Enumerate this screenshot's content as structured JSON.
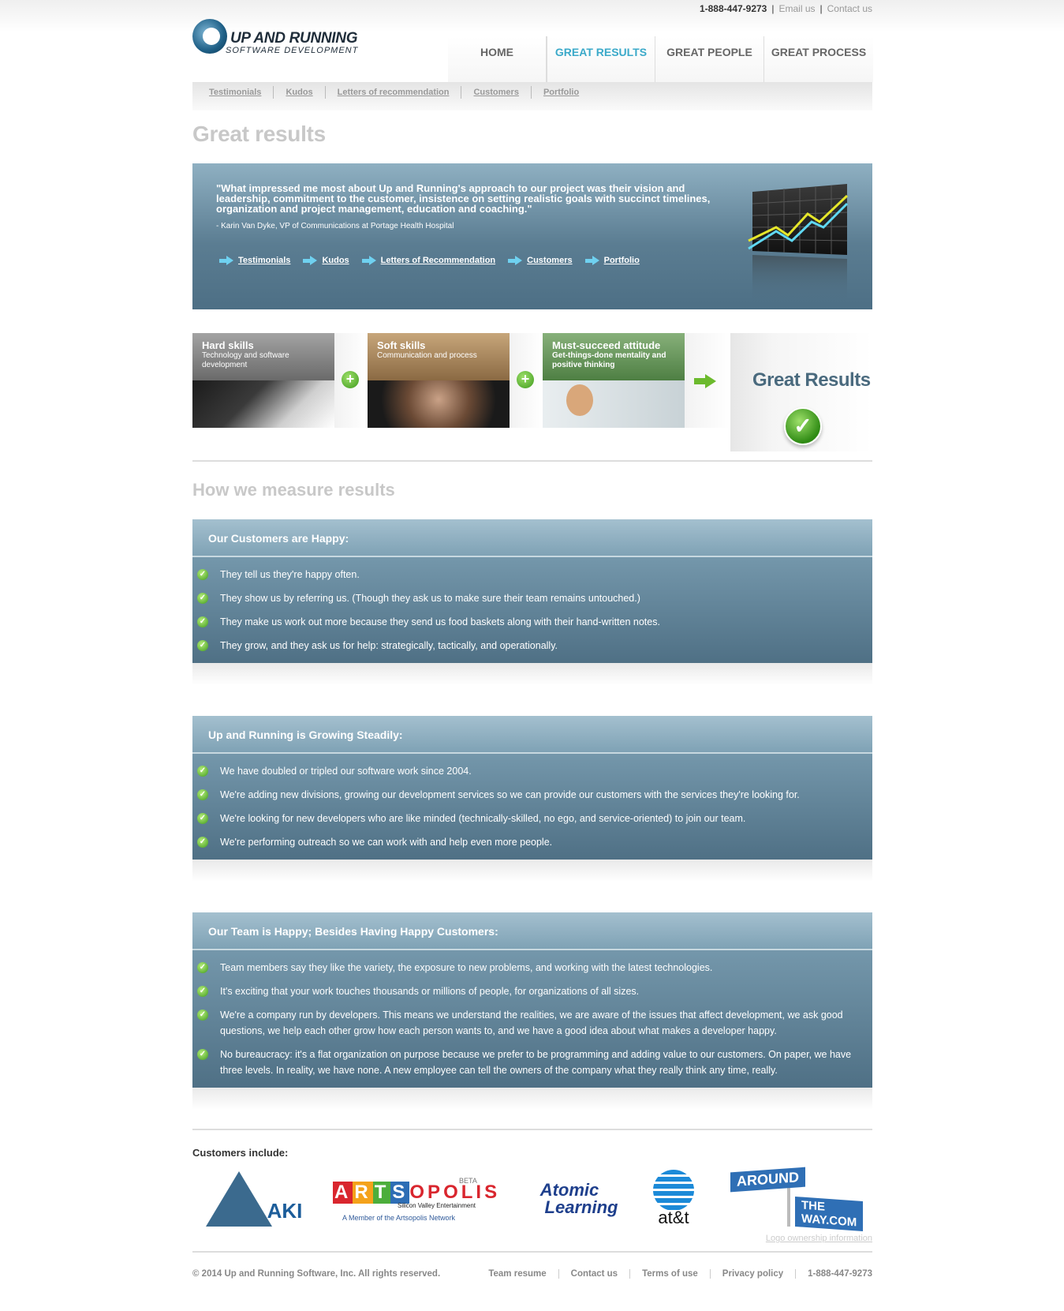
{
  "utility": {
    "phone": "1-888-447-9273",
    "email": "Email us",
    "contact": "Contact us"
  },
  "logo": {
    "line1": "UP AND RUNNING",
    "line2": "SOFTWARE DEVELOPMENT"
  },
  "nav": [
    {
      "label": "HOME"
    },
    {
      "label": "GREAT RESULTS",
      "active": true
    },
    {
      "label": "GREAT PEOPLE"
    },
    {
      "label": "GREAT PROCESS"
    }
  ],
  "subnav": [
    "Testimonials",
    "Kudos",
    "Letters of recommendation",
    "Customers",
    "Portfolio"
  ],
  "page_title": "Great results",
  "banner": {
    "quote": "\"What impressed me most about Up and Running's approach to our project was their vision and leadership, commitment to the customer, insistence on setting realistic goals with succinct timelines, organization and project management, education and coaching.\"",
    "attribution": "- Karin Van Dyke, VP of Communications at Portage Health Hospital",
    "links": [
      "Testimonials",
      "Kudos",
      "Letters of Recommendation",
      "Customers",
      "Portfolio"
    ]
  },
  "skills": [
    {
      "title": "Hard skills",
      "desc": "Technology and software development"
    },
    {
      "title": "Soft skills",
      "desc": "Communication and process"
    },
    {
      "title": "Must-succeed attitude",
      "desc": "Get-things-done mentality and positive thinking"
    }
  ],
  "result_label": "Great Results",
  "measure_title": "How we measure results",
  "panels": [
    {
      "title": "Our Customers are Happy:",
      "items": [
        "They tell us they're happy often.",
        "They show us by referring us. (Though they ask us to make sure their team remains untouched.)",
        "They make us work out more because they send us food baskets along with their hand-written notes.",
        "They grow, and they ask us for help: strategically, tactically, and operationally."
      ]
    },
    {
      "title": "Up and Running is Growing Steadily:",
      "items": [
        "We have doubled or tripled our software work since 2004.",
        "We're adding new divisions, growing our development services so we can provide our customers with the services they're looking for.",
        "We're looking for new developers who are like minded (technically-skilled, no ego, and service-oriented) to join our team.",
        "We're performing outreach so we can work with and help even more people."
      ]
    },
    {
      "title": "Our Team is Happy; Besides Having Happy Customers:",
      "items": [
        "Team members say they like the variety, the exposure to new problems, and working with the latest technologies.",
        "It's exciting that your work touches thousands or millions of people, for organizations of all sizes.",
        "We're a company run by developers. This means we understand the realities, we are aware of the issues that affect development, we ask good questions, we help each other grow how each person wants to, and we have a good idea about what makes a developer happy.",
        "No bureaucracy: it's a flat organization on purpose because we prefer to be programming and adding value to our customers. On paper, we have three levels. In reality, we have none. A new employee can tell the owners of the company what they really think any time, really."
      ]
    }
  ],
  "customers": {
    "label": "Customers include:",
    "aki": "AKI",
    "artsopolis": {
      "beta": "BETA",
      "letters": [
        "A",
        "R",
        "T",
        "S",
        "O",
        "P",
        "O",
        "L",
        "I",
        "S"
      ],
      "sub1": "Silicon Valley Entertainment",
      "sub2": "A Member of the Artsopolis Network"
    },
    "atomic": {
      "line1": "Atomic",
      "line2": "Learning"
    },
    "att": "at&t",
    "atw": {
      "line1": "AROUND",
      "line2": "THE WAY.COM"
    },
    "ownership": "Logo ownership information"
  },
  "footer": {
    "copyright": "© 2014 Up and Running Software, Inc. All rights reserved.",
    "links": [
      "Team resume",
      "Contact us",
      "Terms of use",
      "Privacy policy",
      "1-888-447-9273"
    ]
  },
  "colors": {
    "accent": "#3aa9c9",
    "panel": "#5b7d92",
    "check": "#3e9a1d"
  }
}
